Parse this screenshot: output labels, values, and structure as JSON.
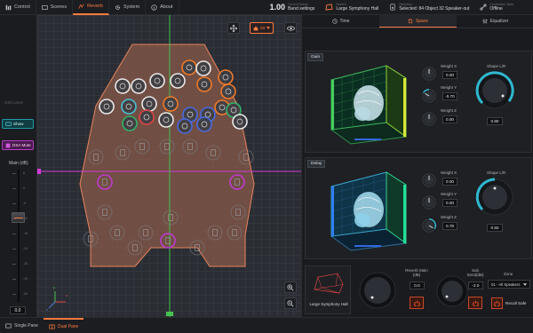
{
  "topbar": {
    "nav": [
      {
        "label": "Control",
        "icon": "control-icon"
      },
      {
        "label": "Scenes",
        "icon": "scenes-icon"
      },
      {
        "label": "Reverb",
        "icon": "reverb-icon",
        "active": true
      },
      {
        "label": "System",
        "icon": "gear-icon"
      },
      {
        "label": "About",
        "icon": "info-icon"
      }
    ],
    "scene_number": "1.00",
    "current_scene_caption": "Current Scene",
    "current_scene_value": "Band settings",
    "reverb_caption": "Reverb",
    "reverb_value": "Large Symphony Hall",
    "selection_caption": "Selection",
    "selection_value": "Selected: 84 Object 32 Speaker-out",
    "connection_caption": "Connection State",
    "connection_value": "Offline"
  },
  "left": {
    "btn_grid": "Grid Lines",
    "btn_show": "Show",
    "btn_dsa": "DSA Mute",
    "main_label": "Main (dB)",
    "main_value": "0.0",
    "scale": [
      "6",
      "0",
      "-6",
      "-12",
      "-18",
      "-24",
      "-30",
      "-40",
      "-60"
    ]
  },
  "canvas": {
    "zone_count": "03",
    "axis_x": "x",
    "axis_y": "y",
    "axis_z": "z"
  },
  "right": {
    "tabs": [
      {
        "label": "Time",
        "icon": "clock-icon"
      },
      {
        "label": "Space",
        "icon": "space-icon",
        "active": true
      },
      {
        "label": "Equalizer",
        "icon": "equalizer-icon"
      }
    ],
    "gain": {
      "tag": "Gain",
      "weight_x_label": "Weight X",
      "weight_x": "0.00",
      "weight_y_label": "Weight Y",
      "weight_y": "-0.70",
      "weight_z_label": "Weight Z",
      "weight_z": "0.00",
      "shape_label": "Shape L/R",
      "shape": "0.80"
    },
    "delay": {
      "tag": "Delay",
      "weight_x_label": "Weight X",
      "weight_x": "0.00",
      "weight_y_label": "Weight Y",
      "weight_y": "0.00",
      "weight_z_label": "Weight Z",
      "weight_z": "0.78",
      "shape_label": "Shape L/R",
      "shape": "0.50"
    },
    "room_name": "Large Symphony Hall",
    "reverb_main_label": "Reverb Main (dB)",
    "reverb_main_value": "0.0",
    "sub_send_label": "Sub Send(dB)",
    "sub_send_value": "-2.0",
    "zone_label": "Zone",
    "zone_value": "01 - All Speakers",
    "recall_label": "Recall Safe"
  },
  "bottom": {
    "tabs": [
      {
        "label": "Single Pane",
        "icon": "single-pane-icon"
      },
      {
        "label": "Dual Pane",
        "icon": "dual-pane-icon",
        "active": true
      }
    ]
  },
  "colors": {
    "accent": "#ff7a3d",
    "stage_fill": "#8a5a4a",
    "stage_stroke": "#e7845e",
    "horizontal_line": "#d23cd8",
    "vertical_line": "#46c24f",
    "show_btn": "#1f9aa6",
    "dsa_btn": "#b73cc2"
  }
}
